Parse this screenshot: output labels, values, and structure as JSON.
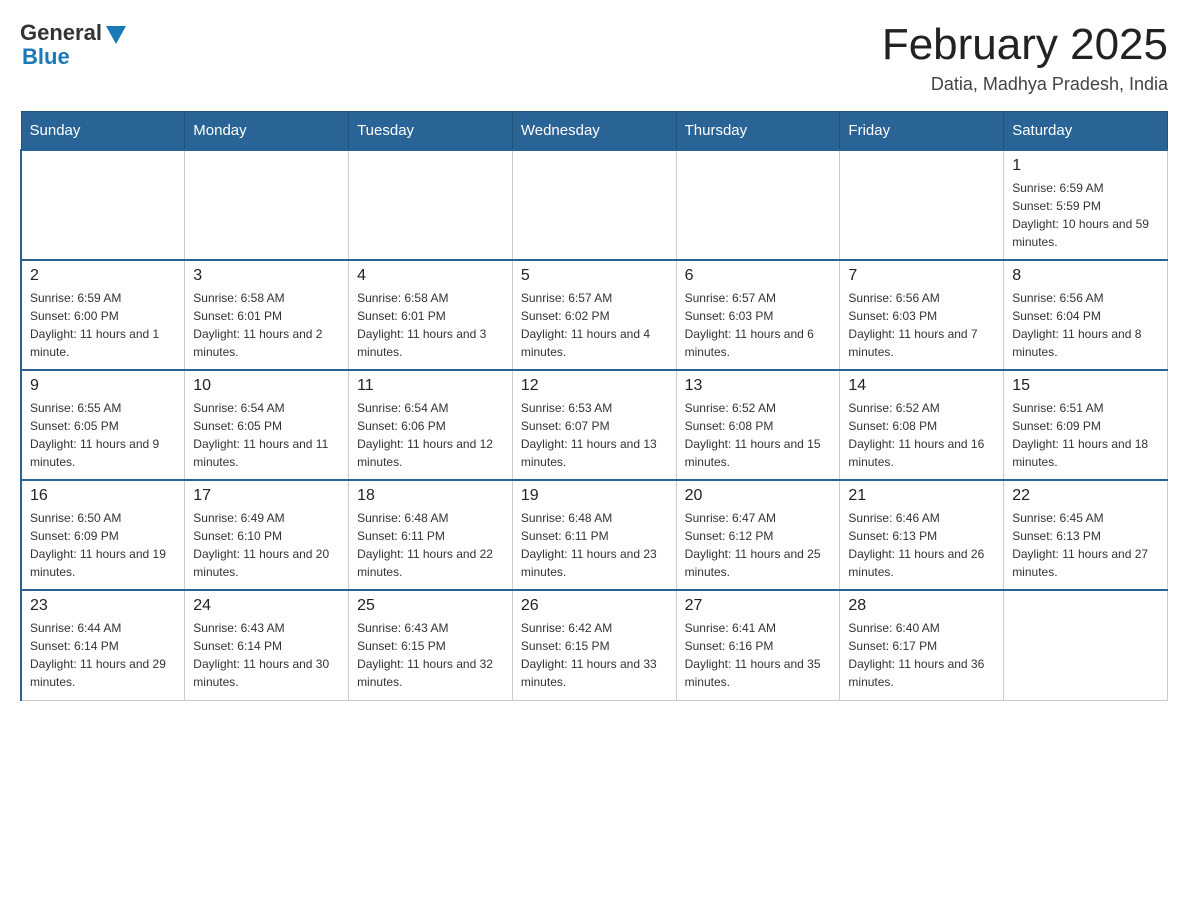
{
  "header": {
    "logo": {
      "general": "General",
      "blue": "Blue"
    },
    "title": "February 2025",
    "location": "Datia, Madhya Pradesh, India"
  },
  "weekdays": [
    "Sunday",
    "Monday",
    "Tuesday",
    "Wednesday",
    "Thursday",
    "Friday",
    "Saturday"
  ],
  "weeks": [
    [
      {
        "day": "",
        "sunrise": "",
        "sunset": "",
        "daylight": ""
      },
      {
        "day": "",
        "sunrise": "",
        "sunset": "",
        "daylight": ""
      },
      {
        "day": "",
        "sunrise": "",
        "sunset": "",
        "daylight": ""
      },
      {
        "day": "",
        "sunrise": "",
        "sunset": "",
        "daylight": ""
      },
      {
        "day": "",
        "sunrise": "",
        "sunset": "",
        "daylight": ""
      },
      {
        "day": "",
        "sunrise": "",
        "sunset": "",
        "daylight": ""
      },
      {
        "day": "1",
        "sunrise": "Sunrise: 6:59 AM",
        "sunset": "Sunset: 5:59 PM",
        "daylight": "Daylight: 10 hours and 59 minutes."
      }
    ],
    [
      {
        "day": "2",
        "sunrise": "Sunrise: 6:59 AM",
        "sunset": "Sunset: 6:00 PM",
        "daylight": "Daylight: 11 hours and 1 minute."
      },
      {
        "day": "3",
        "sunrise": "Sunrise: 6:58 AM",
        "sunset": "Sunset: 6:01 PM",
        "daylight": "Daylight: 11 hours and 2 minutes."
      },
      {
        "day": "4",
        "sunrise": "Sunrise: 6:58 AM",
        "sunset": "Sunset: 6:01 PM",
        "daylight": "Daylight: 11 hours and 3 minutes."
      },
      {
        "day": "5",
        "sunrise": "Sunrise: 6:57 AM",
        "sunset": "Sunset: 6:02 PM",
        "daylight": "Daylight: 11 hours and 4 minutes."
      },
      {
        "day": "6",
        "sunrise": "Sunrise: 6:57 AM",
        "sunset": "Sunset: 6:03 PM",
        "daylight": "Daylight: 11 hours and 6 minutes."
      },
      {
        "day": "7",
        "sunrise": "Sunrise: 6:56 AM",
        "sunset": "Sunset: 6:03 PM",
        "daylight": "Daylight: 11 hours and 7 minutes."
      },
      {
        "day": "8",
        "sunrise": "Sunrise: 6:56 AM",
        "sunset": "Sunset: 6:04 PM",
        "daylight": "Daylight: 11 hours and 8 minutes."
      }
    ],
    [
      {
        "day": "9",
        "sunrise": "Sunrise: 6:55 AM",
        "sunset": "Sunset: 6:05 PM",
        "daylight": "Daylight: 11 hours and 9 minutes."
      },
      {
        "day": "10",
        "sunrise": "Sunrise: 6:54 AM",
        "sunset": "Sunset: 6:05 PM",
        "daylight": "Daylight: 11 hours and 11 minutes."
      },
      {
        "day": "11",
        "sunrise": "Sunrise: 6:54 AM",
        "sunset": "Sunset: 6:06 PM",
        "daylight": "Daylight: 11 hours and 12 minutes."
      },
      {
        "day": "12",
        "sunrise": "Sunrise: 6:53 AM",
        "sunset": "Sunset: 6:07 PM",
        "daylight": "Daylight: 11 hours and 13 minutes."
      },
      {
        "day": "13",
        "sunrise": "Sunrise: 6:52 AM",
        "sunset": "Sunset: 6:08 PM",
        "daylight": "Daylight: 11 hours and 15 minutes."
      },
      {
        "day": "14",
        "sunrise": "Sunrise: 6:52 AM",
        "sunset": "Sunset: 6:08 PM",
        "daylight": "Daylight: 11 hours and 16 minutes."
      },
      {
        "day": "15",
        "sunrise": "Sunrise: 6:51 AM",
        "sunset": "Sunset: 6:09 PM",
        "daylight": "Daylight: 11 hours and 18 minutes."
      }
    ],
    [
      {
        "day": "16",
        "sunrise": "Sunrise: 6:50 AM",
        "sunset": "Sunset: 6:09 PM",
        "daylight": "Daylight: 11 hours and 19 minutes."
      },
      {
        "day": "17",
        "sunrise": "Sunrise: 6:49 AM",
        "sunset": "Sunset: 6:10 PM",
        "daylight": "Daylight: 11 hours and 20 minutes."
      },
      {
        "day": "18",
        "sunrise": "Sunrise: 6:48 AM",
        "sunset": "Sunset: 6:11 PM",
        "daylight": "Daylight: 11 hours and 22 minutes."
      },
      {
        "day": "19",
        "sunrise": "Sunrise: 6:48 AM",
        "sunset": "Sunset: 6:11 PM",
        "daylight": "Daylight: 11 hours and 23 minutes."
      },
      {
        "day": "20",
        "sunrise": "Sunrise: 6:47 AM",
        "sunset": "Sunset: 6:12 PM",
        "daylight": "Daylight: 11 hours and 25 minutes."
      },
      {
        "day": "21",
        "sunrise": "Sunrise: 6:46 AM",
        "sunset": "Sunset: 6:13 PM",
        "daylight": "Daylight: 11 hours and 26 minutes."
      },
      {
        "day": "22",
        "sunrise": "Sunrise: 6:45 AM",
        "sunset": "Sunset: 6:13 PM",
        "daylight": "Daylight: 11 hours and 27 minutes."
      }
    ],
    [
      {
        "day": "23",
        "sunrise": "Sunrise: 6:44 AM",
        "sunset": "Sunset: 6:14 PM",
        "daylight": "Daylight: 11 hours and 29 minutes."
      },
      {
        "day": "24",
        "sunrise": "Sunrise: 6:43 AM",
        "sunset": "Sunset: 6:14 PM",
        "daylight": "Daylight: 11 hours and 30 minutes."
      },
      {
        "day": "25",
        "sunrise": "Sunrise: 6:43 AM",
        "sunset": "Sunset: 6:15 PM",
        "daylight": "Daylight: 11 hours and 32 minutes."
      },
      {
        "day": "26",
        "sunrise": "Sunrise: 6:42 AM",
        "sunset": "Sunset: 6:15 PM",
        "daylight": "Daylight: 11 hours and 33 minutes."
      },
      {
        "day": "27",
        "sunrise": "Sunrise: 6:41 AM",
        "sunset": "Sunset: 6:16 PM",
        "daylight": "Daylight: 11 hours and 35 minutes."
      },
      {
        "day": "28",
        "sunrise": "Sunrise: 6:40 AM",
        "sunset": "Sunset: 6:17 PM",
        "daylight": "Daylight: 11 hours and 36 minutes."
      },
      {
        "day": "",
        "sunrise": "",
        "sunset": "",
        "daylight": ""
      }
    ]
  ]
}
